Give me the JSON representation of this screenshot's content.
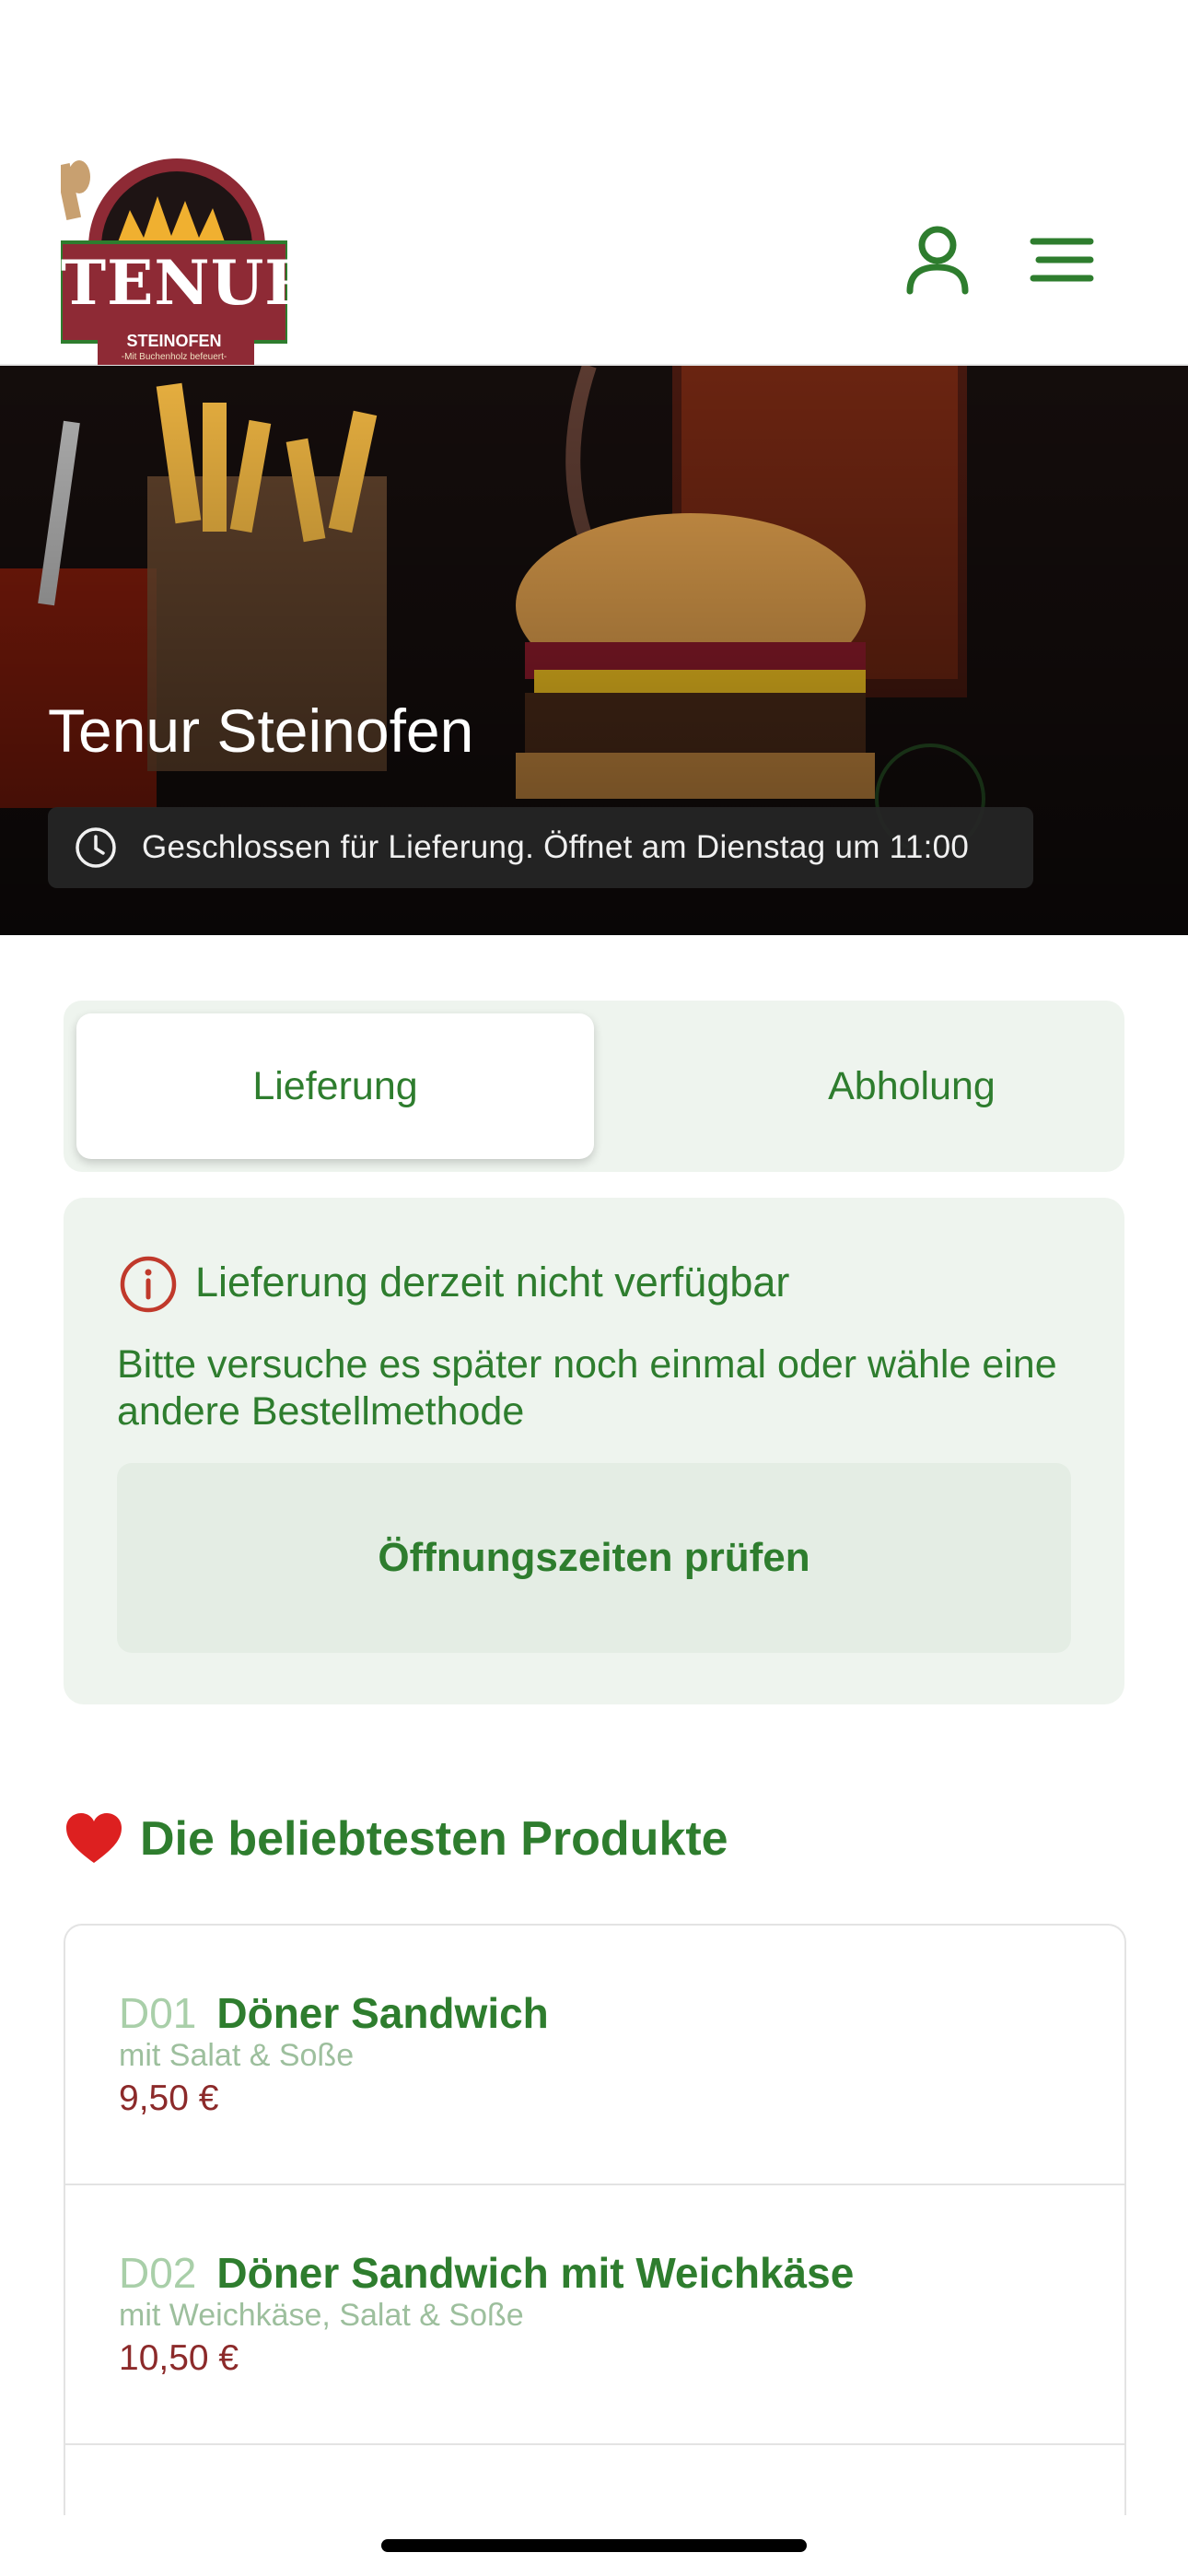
{
  "header": {
    "logo": {
      "text": "TENUR",
      "subtitle": "STEINOFEN",
      "tagline": "-Mit Buchenholz befeuert-"
    },
    "icons": [
      "user-icon",
      "menu-icon"
    ]
  },
  "hero": {
    "title": "Tenur Steinofen",
    "status": "Geschlossen für Lieferung. Öffnet am Dienstag um 11:00"
  },
  "order_mode": {
    "options": [
      "Lieferung",
      "Abholung"
    ],
    "selected": "Lieferung"
  },
  "notice": {
    "title": "Lieferung derzeit nicht verfügbar",
    "body": "Bitte versuche es später noch einmal oder wähle eine andere Bestellmethode",
    "button": "Öffnungszeiten prüfen"
  },
  "popular": {
    "title": "Die beliebtesten Produkte",
    "products": [
      {
        "code": "D01",
        "name": "Döner Sandwich",
        "description": "mit Salat & Soße",
        "price": "9,50 €"
      },
      {
        "code": "D02",
        "name": "Döner Sandwich mit Weichkäse",
        "description": "mit Weichkäse, Salat & Soße",
        "price": "10,50 €"
      }
    ]
  },
  "colors": {
    "accent": "#2e7d2e",
    "price": "#8c2a2a",
    "panel": "#eef4ee",
    "alert": "#c0392b"
  }
}
